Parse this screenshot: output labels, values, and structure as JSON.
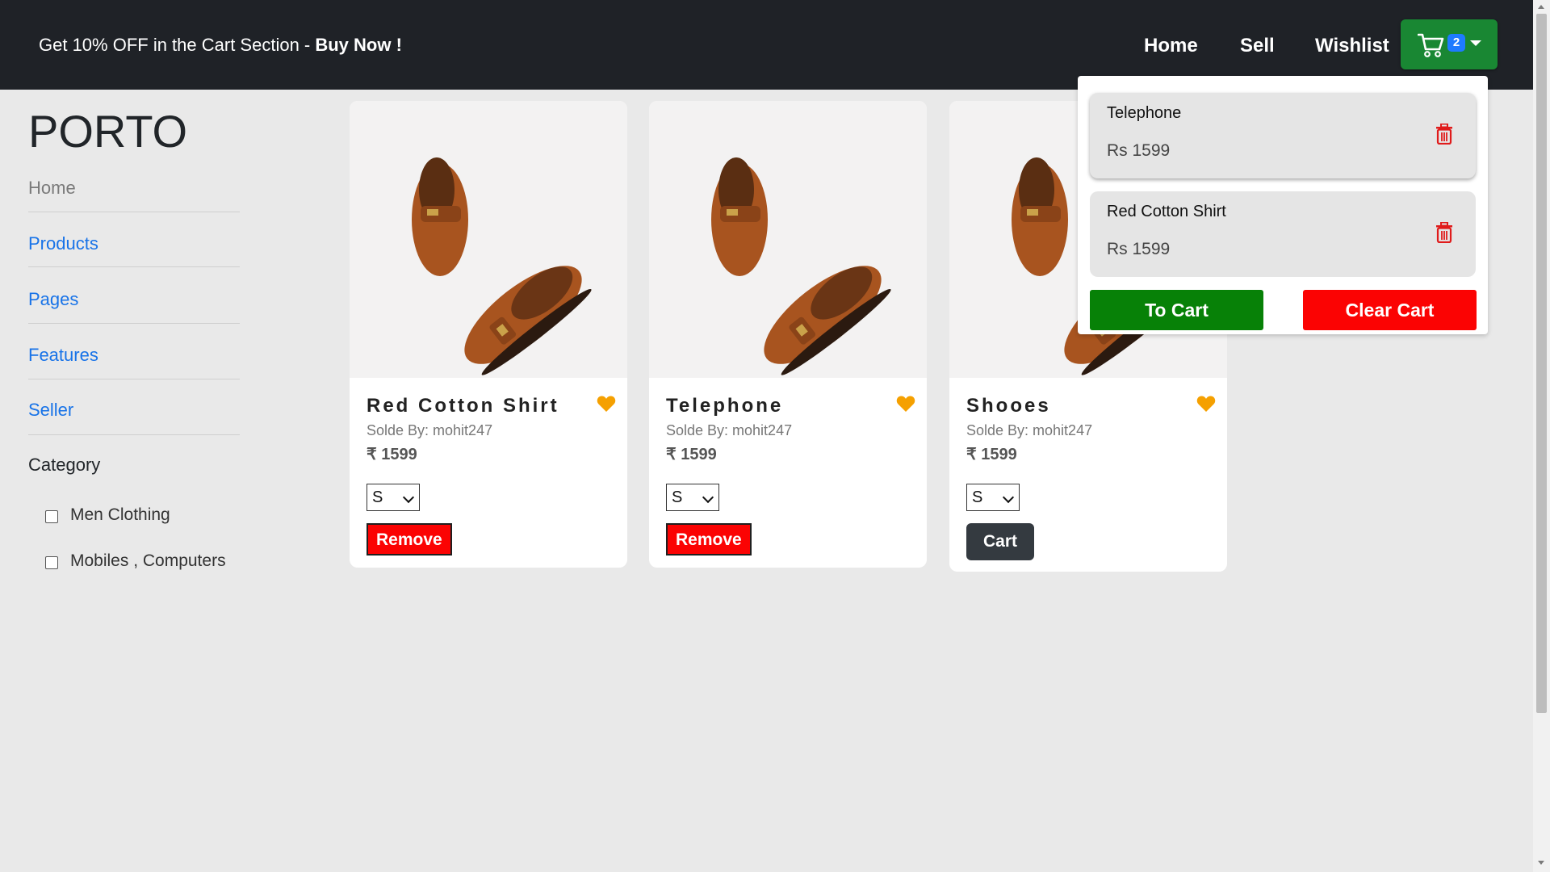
{
  "header": {
    "promo_text": "Get 10% OFF in the Cart Section - ",
    "promo_cta": "Buy Now !",
    "nav": [
      "Home",
      "Sell",
      "Wishlist"
    ],
    "cart_icon": "shopping-cart-icon",
    "cart_count": "2"
  },
  "sidebar": {
    "brand": "PORTO",
    "links": [
      "Home",
      "Products",
      "Pages",
      "Features",
      "Seller"
    ],
    "category_title": "Category",
    "categories": [
      "Men Clothing",
      "Mobiles , Computers"
    ]
  },
  "products": [
    {
      "name": "Red Cotton Shirt",
      "seller": "Solde By: mohit247",
      "price": "₹ 1599",
      "size": "S",
      "action": "Remove",
      "wishlisted": true
    },
    {
      "name": "Telephone",
      "seller": "Solde By: mohit247",
      "price": "₹ 1599",
      "size": "S",
      "action": "Remove",
      "wishlisted": true
    },
    {
      "name": "Shooes",
      "seller": "Solde By: mohit247",
      "price": "₹ 1599",
      "size": "S",
      "action": "Cart",
      "wishlisted": true
    }
  ],
  "cart_dropdown": {
    "items": [
      {
        "name": "Telephone",
        "price": "Rs 1599"
      },
      {
        "name": "Red Cotton Shirt",
        "price": "Rs 1599"
      }
    ],
    "to_cart_label": "To Cart",
    "clear_cart_label": "Clear Cart"
  },
  "colors": {
    "header_bg": "#1f2227",
    "cart_button": "#198733",
    "remove_red": "#fb0303",
    "to_cart_green": "#078107",
    "heart": "#f5a000",
    "link_blue": "#1873e8"
  }
}
